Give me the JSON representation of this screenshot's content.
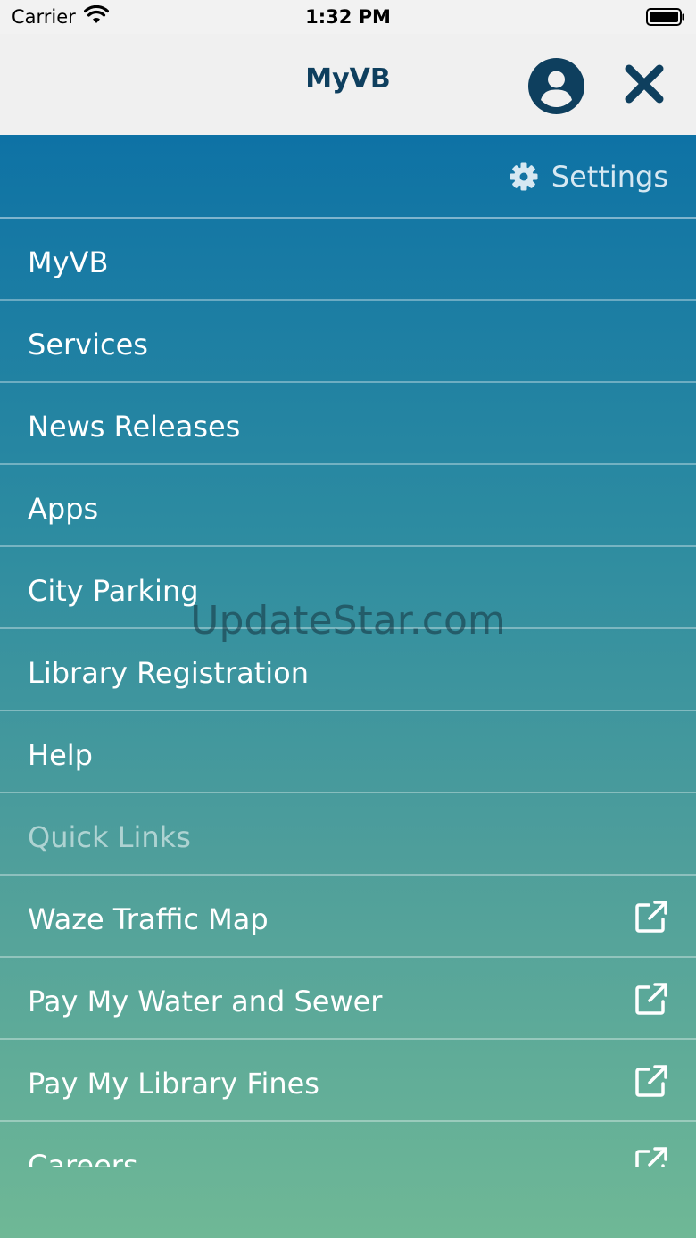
{
  "status_bar": {
    "carrier": "Carrier",
    "time": "1:32 PM"
  },
  "nav": {
    "title": "MyVB",
    "profile_icon": "user-circle-icon",
    "close_icon": "close-icon"
  },
  "menu": {
    "settings_label": "Settings",
    "settings_icon": "gear-icon",
    "items": [
      {
        "label": "MyVB"
      },
      {
        "label": "Services"
      },
      {
        "label": "News Releases"
      },
      {
        "label": "Apps"
      },
      {
        "label": "City Parking"
      },
      {
        "label": "Library Registration"
      },
      {
        "label": "Help"
      }
    ],
    "section_label": "Quick Links",
    "quick_links": [
      {
        "label": "Waze Traffic Map",
        "icon": "external-link-icon"
      },
      {
        "label": "Pay My Water and Sewer",
        "icon": "external-link-icon"
      },
      {
        "label": "Pay My Library Fines",
        "icon": "external-link-icon"
      },
      {
        "label": "Careers",
        "icon": "external-link-icon"
      }
    ]
  },
  "watermark": "UpdateStar.com",
  "colors": {
    "title": "#0e3f5e",
    "menu_top": "#0e72a5",
    "menu_bottom": "#6fb896"
  }
}
